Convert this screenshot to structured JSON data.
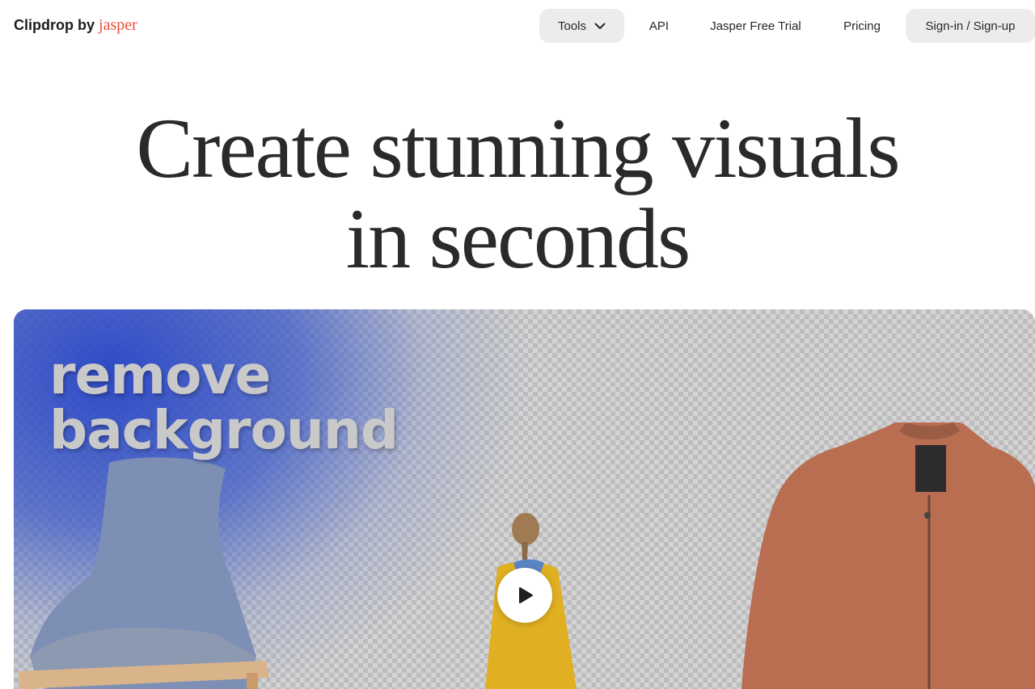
{
  "header": {
    "logo_prefix": "Clipdrop by",
    "logo_brand": "jasper",
    "nav": {
      "tools": "Tools",
      "api": "API",
      "trial": "Jasper Free Trial",
      "pricing": "Pricing",
      "signin": "Sign-in / Sign-up"
    }
  },
  "hero": {
    "headline_line1": "Create stunning visuals",
    "headline_line2": "in seconds",
    "video_text_line1": "remove",
    "video_text_line2": "background"
  },
  "colors": {
    "brand_accent": "#ee4e3a",
    "pill_bg": "#ececec",
    "blue_bg": "#2a48c8"
  }
}
